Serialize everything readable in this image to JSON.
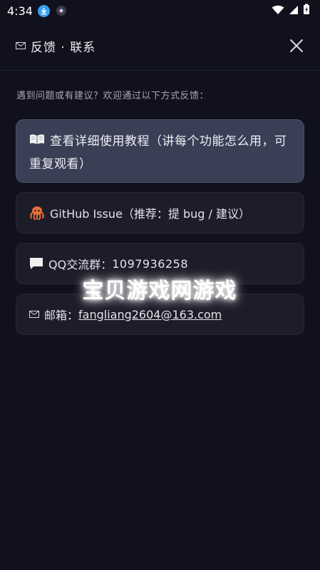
{
  "status": {
    "time": "4:34"
  },
  "header": {
    "title": "反馈 · 联系",
    "icon": "mail-icon"
  },
  "intro": "遇到问题或有建议？欢迎通过以下方式反馈：",
  "cards": {
    "tutorial": {
      "icon": "book-icon",
      "label": "查看详细使用教程（讲每个功能怎么用，可重复观看）"
    },
    "github": {
      "icon": "octopus-icon",
      "label": "GitHub Issue（推荐：提 bug / 建议）"
    },
    "qq": {
      "icon": "chat-bubble-icon",
      "label": "QQ交流群：",
      "number": "1097936258"
    },
    "mail": {
      "icon": "envelope-icon",
      "label": "邮箱：",
      "address": "fangliang2604@163.com"
    }
  },
  "watermark": "宝贝游戏网游戏",
  "colors": {
    "background": "#11111d",
    "card": "#1d1d2a",
    "card_primary": "#3a3f55"
  }
}
